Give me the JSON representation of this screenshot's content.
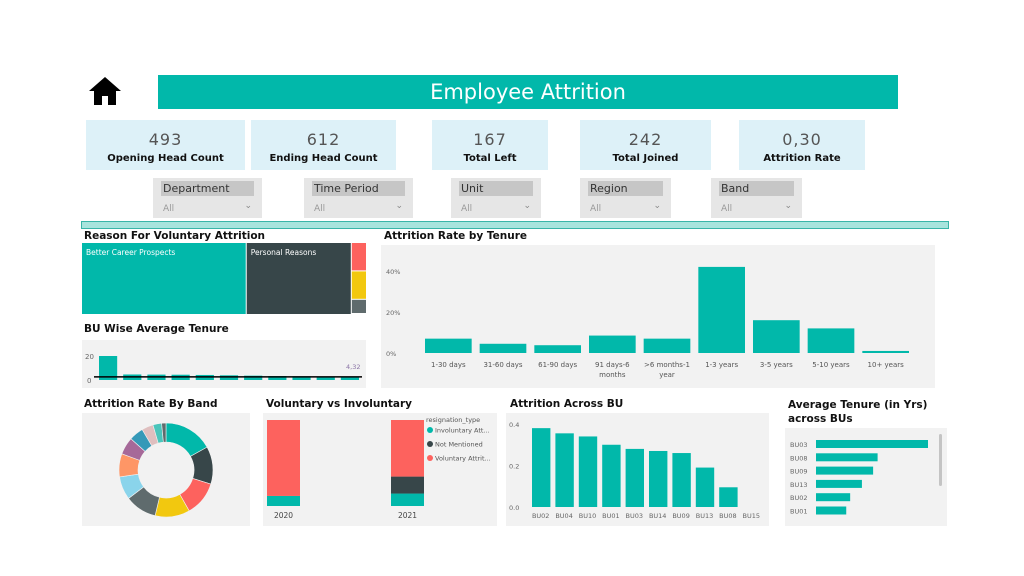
{
  "header": {
    "title": "Employee Attrition",
    "home_icon": "home-icon"
  },
  "kpis": [
    {
      "value": "493",
      "label": "Opening Head Count"
    },
    {
      "value": "612",
      "label": "Ending Head Count"
    },
    {
      "value": "167",
      "label": "Total Left"
    },
    {
      "value": "242",
      "label": "Total Joined"
    },
    {
      "value": "0,30",
      "label": "Attrition Rate"
    }
  ],
  "slicers": [
    {
      "label": "Department",
      "value": "All"
    },
    {
      "label": "Time Period",
      "value": "All"
    },
    {
      "label": "Unit",
      "value": "All"
    },
    {
      "label": "Region",
      "value": "All"
    },
    {
      "label": "Band",
      "value": "All"
    }
  ],
  "colors": {
    "accent": "#01B8AA",
    "dark": "#374649",
    "red": "#FD625E",
    "yellow": "#F2C80F",
    "gray": "#5F6B6D",
    "kpi_bg": "#DDF1F8"
  },
  "chart_data": [
    {
      "type": "treemap",
      "title": "Reason For Voluntary Attrition",
      "categories": [
        "Better Career Prospects",
        "Personal Reasons",
        "",
        "",
        ""
      ],
      "values": [
        58,
        37,
        2,
        2,
        1
      ],
      "colors": [
        "#01B8AA",
        "#374649",
        "#FD625E",
        "#F2C80F",
        "#5F6B6D"
      ]
    },
    {
      "type": "bar",
      "title": "BU Wise Average Tenure",
      "values": [
        20,
        4.6,
        4.5,
        4.4,
        4.2,
        3.9,
        3.6,
        3.3,
        3.1,
        2.6,
        2.1
      ],
      "yticks": [
        "0",
        "20"
      ],
      "ylim": [
        0,
        20
      ],
      "reference_line": {
        "value": 4.32,
        "label": "4,32"
      }
    },
    {
      "type": "bar",
      "title": "Attrition Rate by Tenure",
      "categories": [
        "1-30 days",
        "31-60 days",
        "61-90 days",
        "91 days-6 months",
        ">6 months-1 year",
        "1-3 years",
        "3-5 years",
        "5-10 years",
        "10+ years"
      ],
      "values": [
        7,
        4.5,
        3.8,
        8.5,
        7,
        42,
        16,
        12,
        1
      ],
      "yticks": [
        "0%",
        "20%",
        "40%"
      ],
      "ylim": [
        0,
        48
      ]
    },
    {
      "type": "pie",
      "title": "Attrition Rate By Band",
      "values": [
        17,
        13,
        12,
        12,
        11,
        8,
        8,
        6,
        5,
        4,
        3,
        1.5
      ],
      "colors": [
        "#01B8AA",
        "#374649",
        "#FD625E",
        "#F2C80F",
        "#5F6B6D",
        "#8AD4EB",
        "#FE9666",
        "#A66999",
        "#3599B8",
        "#DFBFBF",
        "#4AC5BB",
        "#5F6B6D"
      ]
    },
    {
      "type": "bar",
      "title": "Voluntary vs Involuntary",
      "stacked": true,
      "categories": [
        "2020",
        "2021"
      ],
      "legend_title": "resignation_type",
      "series": [
        {
          "name": "Involuntary Att...",
          "values": [
            9,
            11
          ],
          "color": "#01B8AA"
        },
        {
          "name": "Not Mentioned",
          "values": [
            0,
            15
          ],
          "color": "#374649"
        },
        {
          "name": "Voluntary Attrit...",
          "values": [
            68,
            50
          ],
          "color": "#FD625E"
        }
      ]
    },
    {
      "type": "bar",
      "title": "Attrition Across BU",
      "categories": [
        "BU02",
        "BU04",
        "BU10",
        "BU01",
        "BU03",
        "BU14",
        "BU09",
        "BU13",
        "BU08",
        "BU15"
      ],
      "values": [
        0.38,
        0.355,
        0.34,
        0.3,
        0.28,
        0.27,
        0.26,
        0.19,
        0.095,
        0
      ],
      "yticks": [
        "0.0",
        "0.2",
        "0.4"
      ],
      "ylim": [
        0,
        0.4
      ]
    },
    {
      "type": "bar",
      "orientation": "horizontal",
      "title": "Average Tenure (in Yrs) across BUs",
      "categories": [
        "BU03",
        "BU08",
        "BU09",
        "BU13",
        "BU02",
        "BU01"
      ],
      "values": [
        20,
        11,
        10.2,
        8.2,
        6.1,
        5.4
      ]
    }
  ]
}
